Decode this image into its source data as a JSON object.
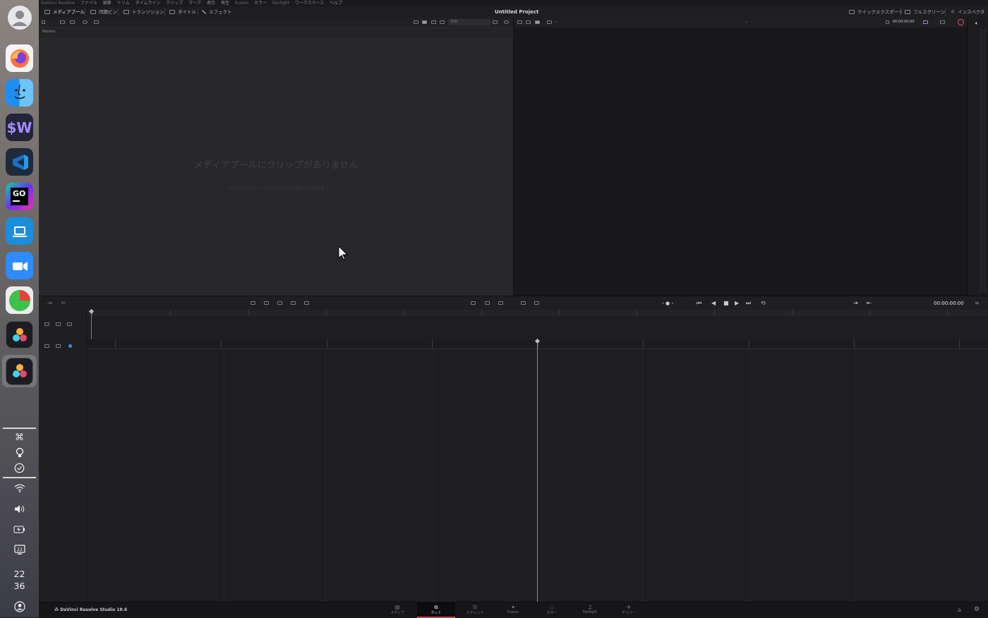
{
  "dock": {
    "apps": [
      {
        "name": "Firefox",
        "icon": "firefox-icon"
      },
      {
        "name": "Finder",
        "icon": "finder-icon"
      },
      {
        "name": "$W",
        "icon": "terminal-w-icon"
      },
      {
        "name": "Visual Studio Code",
        "icon": "vscode-icon"
      },
      {
        "name": "GO",
        "icon": "goland-icon"
      },
      {
        "name": "Remote Desktop",
        "icon": "remote-desktop-icon"
      },
      {
        "name": "Zoom",
        "icon": "zoom-icon"
      },
      {
        "name": "Chart",
        "icon": "pie-chart-app-icon"
      },
      {
        "name": "DaVinci Resolve",
        "icon": "davinci-resolve-icon"
      },
      {
        "name": "DaVinci Resolve Studio",
        "icon": "davinci-resolve-active-icon"
      }
    ],
    "glyph_cmd": "⌘",
    "clock_hour": "22",
    "clock_minute": "36"
  },
  "menubar": {
    "items": [
      "DaVinci Resolve",
      "ファイル",
      "編集",
      "トリム",
      "タイムライン",
      "クリップ",
      "マーク",
      "表示",
      "再生",
      "Fusion",
      "カラー",
      "Fairlight",
      "ワークスペース",
      "ヘルプ"
    ]
  },
  "toolbar": {
    "media_pool": "メディアプール",
    "sync_bin": "同期ビン",
    "transitions": "トランジション",
    "titles": "タイトル",
    "effects": "エフェクト",
    "project_title": "Untitled Project",
    "quick_export": "クイックエクスポート",
    "fullscreen": "フルスクリーン",
    "inspector": "インスペクタ"
  },
  "media_pool": {
    "breadcrumb": "Master",
    "search_placeholder": "検索",
    "empty_title": "メディアプールにクリップがありません",
    "empty_hint": "メディアストレージからクリップを追加して始める"
  },
  "viewer": {
    "timecode_small": "00:00:00:00"
  },
  "transport": {
    "timecode": "00:00:00:00"
  },
  "pages": [
    {
      "label": "メディア",
      "glyph": "▤",
      "active": false
    },
    {
      "label": "カット",
      "glyph": "⧉",
      "active": true
    },
    {
      "label": "エディット",
      "glyph": "☷",
      "active": false
    },
    {
      "label": "Fusion",
      "glyph": "✦",
      "active": false
    },
    {
      "label": "カラー",
      "glyph": "◌",
      "active": false
    },
    {
      "label": "Fairlight",
      "glyph": "♫",
      "active": false
    },
    {
      "label": "デリバー",
      "glyph": "✈",
      "active": false
    }
  ],
  "bottom": {
    "brand": "DaVinci Resolve Studio 18.6"
  },
  "colors": {
    "accent_red": "#d24040",
    "blue_dot": "#3a8ee8"
  }
}
